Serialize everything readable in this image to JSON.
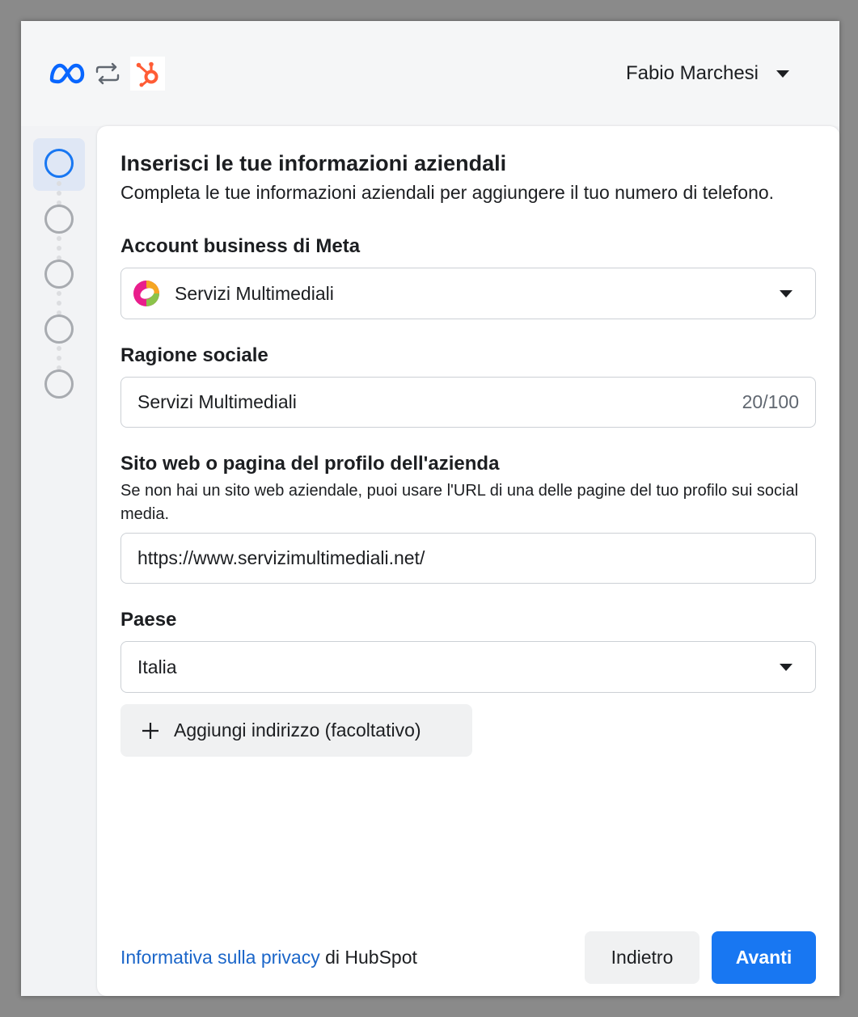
{
  "header": {
    "user_name": "Fabio Marchesi",
    "logos": [
      "meta-logo",
      "sync-icon",
      "hubspot-logo"
    ]
  },
  "stepper": {
    "total_steps": 5,
    "active_step": 1
  },
  "form": {
    "title": "Inserisci le tue informazioni aziendali",
    "subtitle": "Completa le tue informazioni aziendali per aggiungere il tuo numero di telefono.",
    "business_account": {
      "label": "Account business di Meta",
      "value": "Servizi Multimediali"
    },
    "company_name": {
      "label": "Ragione sociale",
      "value": "Servizi Multimediali",
      "counter": "20/100"
    },
    "website": {
      "label": "Sito web o pagina del profilo dell'azienda",
      "help": "Se non hai un sito web aziendale, puoi usare l'URL di una delle pagine del tuo profilo sui social media.",
      "value": "https://www.servizimultimediali.net/"
    },
    "country": {
      "label": "Paese",
      "value": "Italia"
    },
    "add_address_label": "Aggiungi indirizzo (facoltativo)"
  },
  "footer": {
    "privacy_link": "Informativa sulla privacy",
    "privacy_suffix": " di HubSpot",
    "back_label": "Indietro",
    "next_label": "Avanti"
  },
  "colors": {
    "accent": "#1877f2",
    "link": "#1b66c9",
    "hubspot": "#ff5c35"
  }
}
